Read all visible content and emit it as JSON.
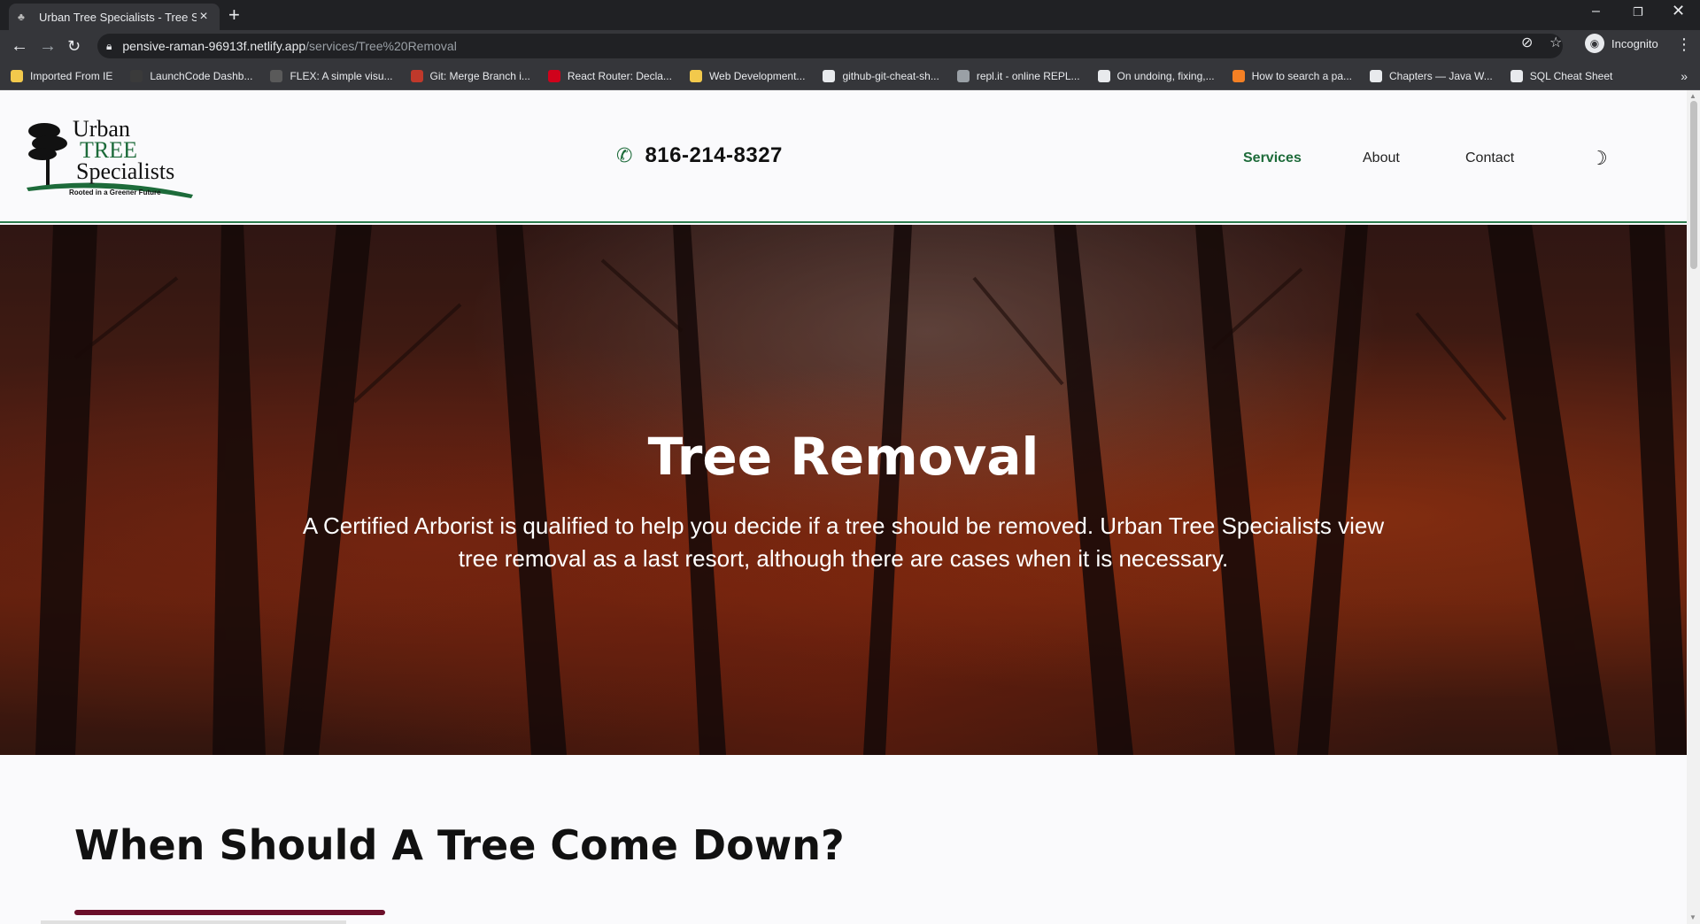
{
  "browser": {
    "tab_title": "Urban Tree Specialists - Tree Serv",
    "url_host": "pensive-raman-96913f.netlify.app",
    "url_path": "/services/Tree%20Removal",
    "profile_label": "Incognito",
    "bookmarks": [
      {
        "label": "Imported From IE",
        "icon": "folder-icon",
        "color": "#f2c94c"
      },
      {
        "label": "LaunchCode Dashb...",
        "icon": "launchcode-icon",
        "color": "#3a3a3a"
      },
      {
        "label": "FLEX: A simple visu...",
        "icon": "flex-icon",
        "color": "#5a5a5a"
      },
      {
        "label": "Git: Merge Branch i...",
        "icon": "sa-icon",
        "color": "#c0392b"
      },
      {
        "label": "React Router: Decla...",
        "icon": "react-router-icon",
        "color": "#d0021b"
      },
      {
        "label": "Web Development...",
        "icon": "web-dev-icon",
        "color": "#f2c94c"
      },
      {
        "label": "github-git-cheat-sh...",
        "icon": "github-icon",
        "color": "#e8eaed"
      },
      {
        "label": "repl.it - online REPL...",
        "icon": "replit-icon",
        "color": "#9aa0a6"
      },
      {
        "label": "On undoing, fixing,...",
        "icon": "atlassian-icon",
        "color": "#e8eaed"
      },
      {
        "label": "How to search a pa...",
        "icon": "stackoverflow-icon",
        "color": "#f48024"
      },
      {
        "label": "Chapters — Java W...",
        "icon": "globe-icon",
        "color": "#e8eaed"
      },
      {
        "label": "SQL Cheat Sheet",
        "icon": "globe-icon",
        "color": "#e8eaed"
      }
    ]
  },
  "site": {
    "logo": {
      "line1": "Urban",
      "line2": "TREE",
      "line3": "Specialists",
      "tagline": "Rooted in a Greener Future"
    },
    "phone": "816-214-8327",
    "nav": [
      {
        "label": "Services",
        "active": true
      },
      {
        "label": "About",
        "active": false
      },
      {
        "label": "Contact",
        "active": false
      }
    ],
    "accent_color": "#1d6b3a",
    "underline_color": "#6b0f2a"
  },
  "hero": {
    "title": "Tree Removal",
    "text_line1": "A Certified Arborist is qualified to help you decide if a tree should be removed. Urban Tree Specialists view",
    "text_line2": "tree removal as a last resort, although there are cases when it is necessary."
  },
  "section": {
    "title": "When Should A Tree Come Down?"
  }
}
